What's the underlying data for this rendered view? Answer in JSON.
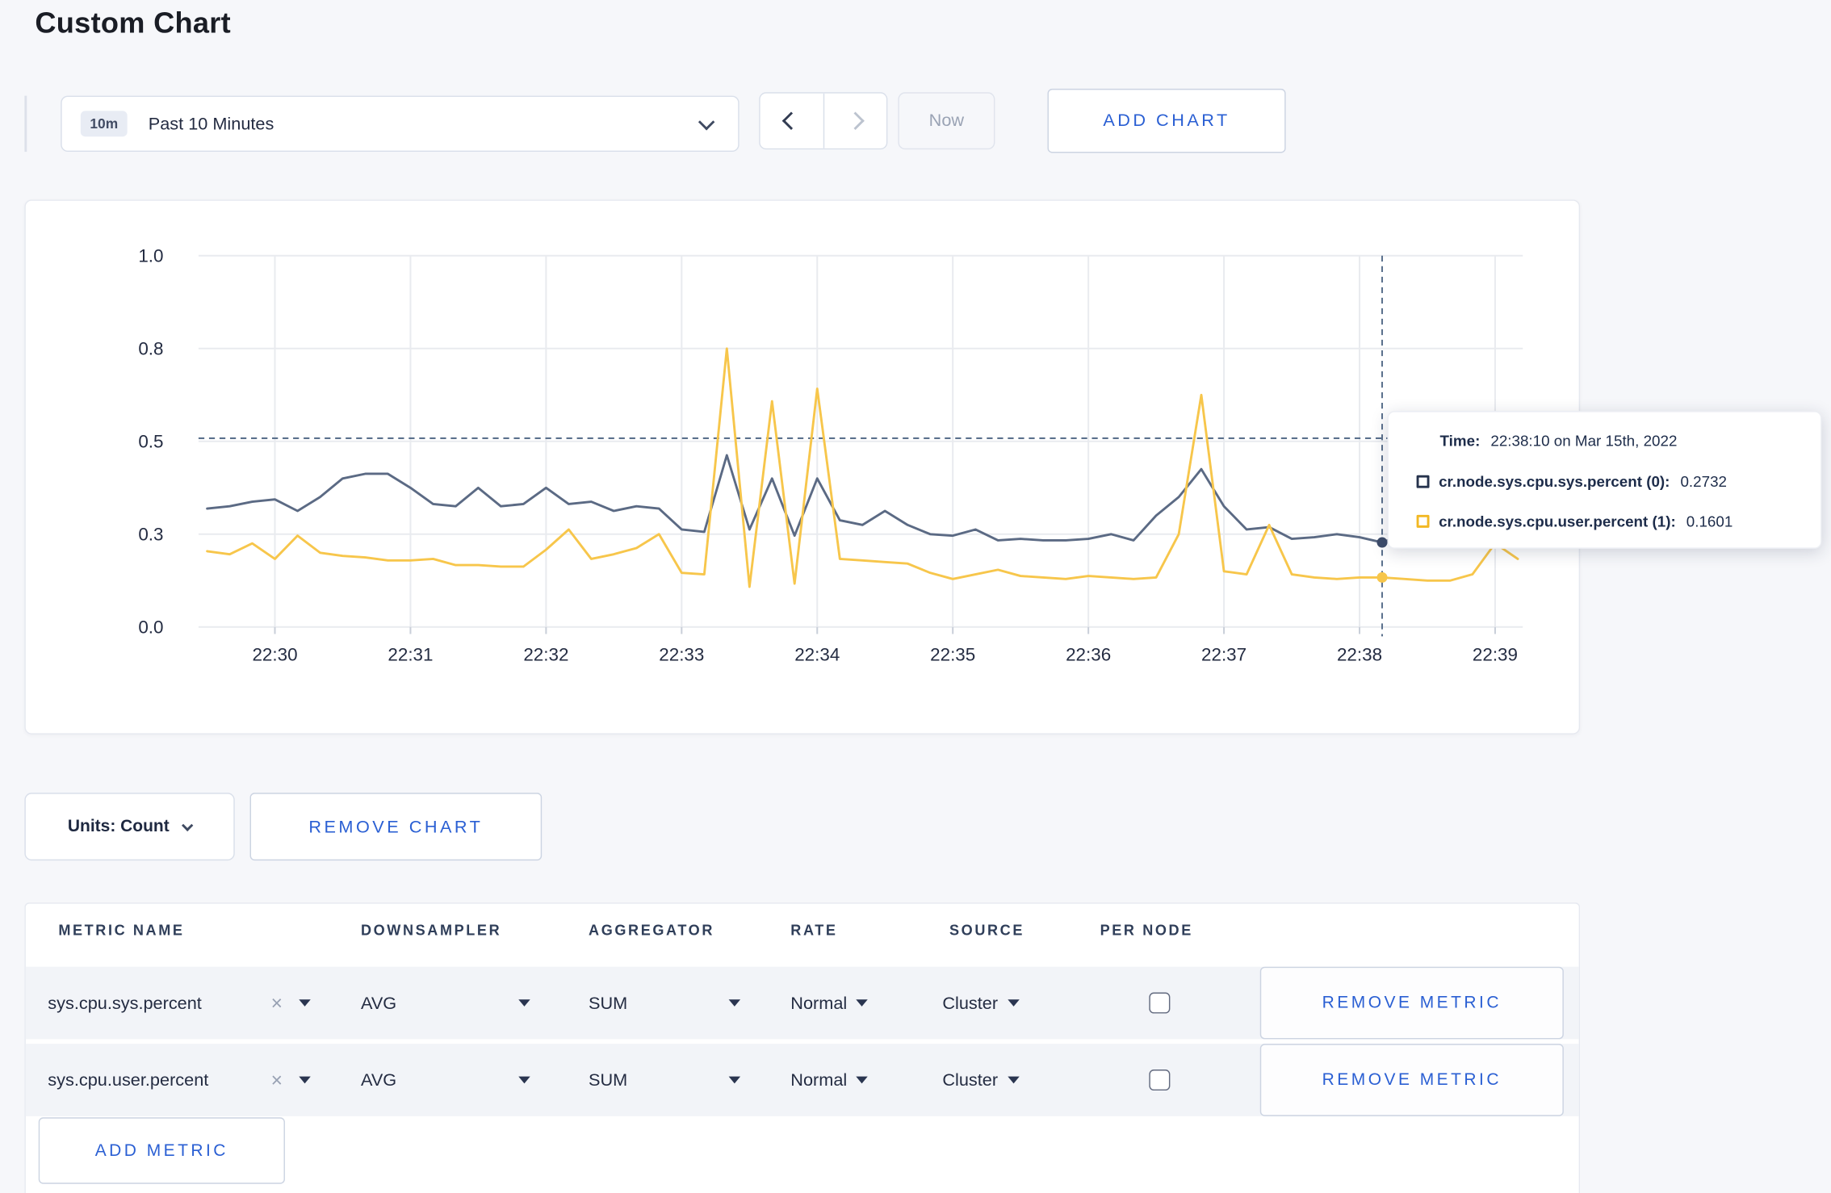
{
  "page": {
    "title": "Custom Chart"
  },
  "toolbar": {
    "range_badge": "10m",
    "range_label": "Past 10 Minutes",
    "now_label": "Now",
    "add_chart_label": "ADD CHART"
  },
  "icons": {
    "close_glyph": "×",
    "names": [
      "chevron-down-icon",
      "chevron-left-icon",
      "chevron-right-icon",
      "caret-down-icon",
      "close-x-icon",
      "square-outline-swatch",
      "checkbox-unchecked"
    ]
  },
  "colors": {
    "accent_blue": "#2a5fd3",
    "navy_text": "#242c42",
    "series_sys": "#5b6a84",
    "series_user": "#f7c64b",
    "crosshair": "#5b718d",
    "gridline": "#e9ebef"
  },
  "chart_data": {
    "type": "line",
    "title": "",
    "xlabel": "",
    "ylabel": "",
    "ylim": [
      0,
      1
    ],
    "grid": true,
    "legend_position": "none",
    "y_ticks": [
      0.0,
      0.3,
      0.5,
      0.8,
      1.0
    ],
    "y_tick_labels": [
      "0.0",
      "0.3",
      "0.5",
      "0.8",
      "1.0"
    ],
    "x_tick_labels": [
      "22:30",
      "22:31",
      "22:32",
      "22:33",
      "22:34",
      "22:35",
      "22:36",
      "22:37",
      "22:38",
      "22:39"
    ],
    "x": [
      "22:29:30",
      "22:29:40",
      "22:29:50",
      "22:30:00",
      "22:30:10",
      "22:30:20",
      "22:30:30",
      "22:30:40",
      "22:30:50",
      "22:31:00",
      "22:31:10",
      "22:31:20",
      "22:31:30",
      "22:31:40",
      "22:31:50",
      "22:32:00",
      "22:32:10",
      "22:32:20",
      "22:32:30",
      "22:32:40",
      "22:32:50",
      "22:33:00",
      "22:33:10",
      "22:33:20",
      "22:33:30",
      "22:33:40",
      "22:33:50",
      "22:34:00",
      "22:34:10",
      "22:34:20",
      "22:34:30",
      "22:34:40",
      "22:34:50",
      "22:35:00",
      "22:35:10",
      "22:35:20",
      "22:35:30",
      "22:35:40",
      "22:35:50",
      "22:36:00",
      "22:36:10",
      "22:36:20",
      "22:36:30",
      "22:36:40",
      "22:36:50",
      "22:37:00",
      "22:37:10",
      "22:37:20",
      "22:37:30",
      "22:37:40",
      "22:37:50",
      "22:38:00",
      "22:38:10",
      "22:38:20",
      "22:38:30",
      "22:38:40",
      "22:38:50",
      "22:39:00",
      "22:39:10"
    ],
    "series": [
      {
        "name": "cr.node.sys.cpu.sys.percent (0)",
        "color": "#5b6a84",
        "dot_color": "#3d4c6a",
        "values": [
          0.355,
          0.36,
          0.37,
          0.375,
          0.35,
          0.38,
          0.42,
          0.43,
          0.43,
          0.4,
          0.365,
          0.36,
          0.4,
          0.36,
          0.365,
          0.4,
          0.365,
          0.37,
          0.35,
          0.36,
          0.355,
          0.31,
          0.305,
          0.47,
          0.31,
          0.42,
          0.295,
          0.42,
          0.33,
          0.32,
          0.35,
          0.32,
          0.3,
          0.295,
          0.31,
          0.28,
          0.285,
          0.28,
          0.28,
          0.285,
          0.3,
          0.28,
          0.34,
          0.38,
          0.44,
          0.36,
          0.31,
          0.315,
          0.285,
          0.29,
          0.3,
          0.29,
          0.2732,
          0.3,
          0.315,
          0.3,
          0.305,
          0.32,
          0.305
        ]
      },
      {
        "name": "cr.node.sys.cpu.user.percent (1)",
        "color": "#f7c64b",
        "dot_color": "#f7c64b",
        "values": [
          0.245,
          0.235,
          0.27,
          0.22,
          0.295,
          0.24,
          0.23,
          0.225,
          0.215,
          0.215,
          0.22,
          0.2,
          0.2,
          0.195,
          0.195,
          0.25,
          0.31,
          0.22,
          0.235,
          0.255,
          0.3,
          0.175,
          0.17,
          0.8,
          0.13,
          0.63,
          0.14,
          0.67,
          0.22,
          0.215,
          0.21,
          0.205,
          0.175,
          0.155,
          0.17,
          0.185,
          0.165,
          0.16,
          0.155,
          0.165,
          0.16,
          0.155,
          0.16,
          0.3,
          0.65,
          0.18,
          0.17,
          0.32,
          0.17,
          0.16,
          0.155,
          0.16,
          0.1601,
          0.155,
          0.15,
          0.15,
          0.17,
          0.27,
          0.22
        ]
      }
    ],
    "crosshair": {
      "time": "22:38:10",
      "y_value": 0.51
    }
  },
  "tooltip": {
    "time_label": "Time:",
    "time_value": "22:38:10 on Mar 15th, 2022",
    "rows": [
      {
        "label": "cr.node.sys.cpu.sys.percent (0):",
        "value": "0.2732",
        "color": "#26334d"
      },
      {
        "label": "cr.node.sys.cpu.user.percent (1):",
        "value": "0.1601",
        "color": "#f2b824"
      }
    ]
  },
  "chart_controls": {
    "units_label": "Units: Count",
    "remove_chart_label": "REMOVE CHART"
  },
  "metrics_table": {
    "headers": [
      "METRIC NAME",
      "DOWNSAMPLER",
      "AGGREGATOR",
      "RATE",
      "SOURCE",
      "PER NODE"
    ],
    "rows": [
      {
        "metric_name": "sys.cpu.sys.percent",
        "downsampler": "AVG",
        "aggregator": "SUM",
        "rate": "Normal",
        "source": "Cluster",
        "per_node_checked": false,
        "remove_label": "REMOVE METRIC"
      },
      {
        "metric_name": "sys.cpu.user.percent",
        "downsampler": "AVG",
        "aggregator": "SUM",
        "rate": "Normal",
        "source": "Cluster",
        "per_node_checked": false,
        "remove_label": "REMOVE METRIC"
      }
    ],
    "add_metric_label": "ADD METRIC"
  }
}
